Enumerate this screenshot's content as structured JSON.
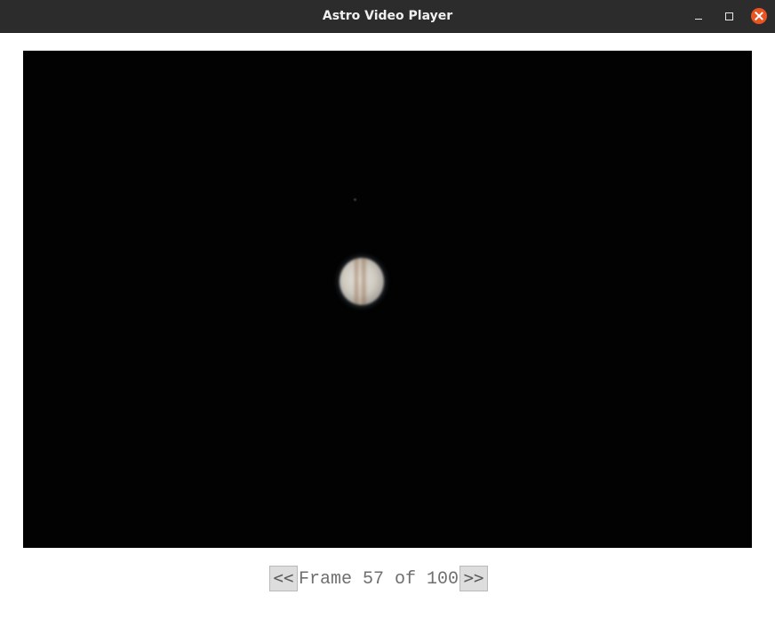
{
  "window": {
    "title": "Astro Video Player",
    "close_color": "#e95420"
  },
  "titlebar_buttons": [
    {
      "name": "minimize",
      "icon": "minimize-icon"
    },
    {
      "name": "maximize",
      "icon": "maximize-icon"
    },
    {
      "name": "close",
      "icon": "close-icon"
    }
  ],
  "video": {
    "subject_icon": "planet-jupiter",
    "background_color": "#020202"
  },
  "controls": {
    "prev_label": "<<",
    "frame_label": "Frame 57 of 100",
    "next_label": ">>"
  }
}
